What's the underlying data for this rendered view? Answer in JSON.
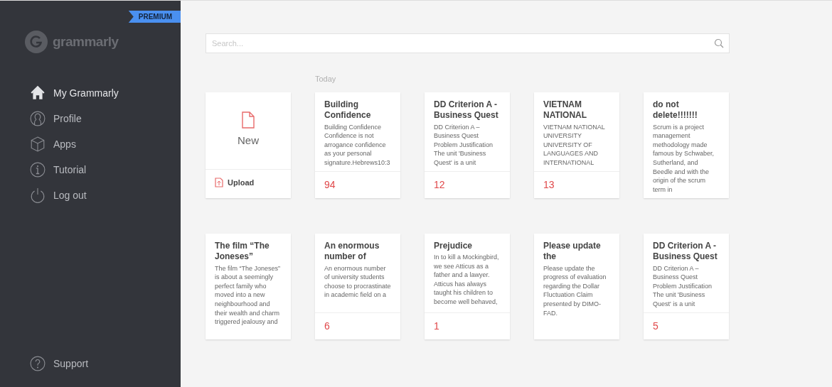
{
  "sidebar": {
    "badge": "PREMIUM",
    "logo_text": "grammarly",
    "items": [
      {
        "label": "My Grammarly",
        "kind": "home",
        "selected": true
      },
      {
        "label": "Profile",
        "kind": "profile",
        "selected": false
      },
      {
        "label": "Apps",
        "kind": "apps",
        "selected": false
      },
      {
        "label": "Tutorial",
        "kind": "info",
        "selected": false
      },
      {
        "label": "Log out",
        "kind": "power",
        "selected": false
      }
    ],
    "support": "Support"
  },
  "search": {
    "placeholder": "Search..."
  },
  "section": "Today",
  "new_card": {
    "label": "New",
    "upload": "Upload"
  },
  "documents": [
    {
      "title": "Building Confidence",
      "snippet": "Building Confidence Confidence is not arrogance confidence as your personal signature.Hebrews10:3",
      "count": "94"
    },
    {
      "title": "DD Criterion A - Business Quest",
      "snippet": "DD Criterion A – Business Quest Problem Justification The unit 'Business Quest' is a unit",
      "count": "12"
    },
    {
      "title": "VIETNAM NATIONAL",
      "snippet": "VIETNAM NATIONAL UNIVERSITY UNIVERSITY OF LANGUAGES AND INTERNATIONAL",
      "count": "13"
    },
    {
      "title": "do not delete!!!!!!!",
      "snippet": "Scrum is a project management methodology made famous by Schwaber, Sutherland, and Beedle and with the origin of the scrum term in"
    },
    {
      "title": "The film “The Joneses”",
      "snippet": "The film “The Joneses” is about a seemingly perfect family who moved into a new neighbourhood and their wealth and charm triggered jealousy and"
    },
    {
      "title": "An enormous number of",
      "snippet": "An enormous number of university students choose to procrastinate in academic field on a",
      "count": "6"
    },
    {
      "title": "Prejudice",
      "snippet": "In to kill a Mockingbird, we see Atticus as a father and a lawyer. Atticus has always taught his children to become well behaved,",
      "count": "1"
    },
    {
      "title": "Please update the",
      "snippet": "Please update the progress of evaluation regarding the Dollar Fluctuation Claim presented by DIMO-FAD."
    },
    {
      "title": "DD Criterion A - Business Quest",
      "snippet": "DD Criterion A – Business Quest Problem Justification The unit 'Business Quest' is a unit",
      "count": "5"
    }
  ]
}
